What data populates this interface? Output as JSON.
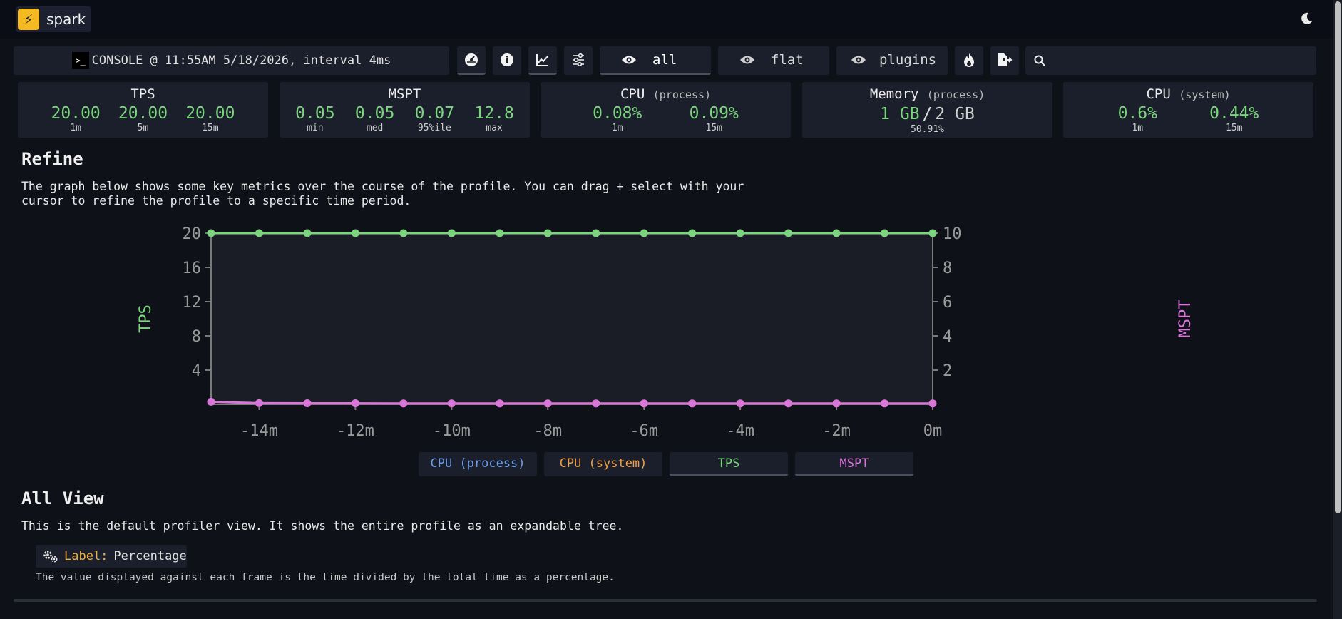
{
  "app": {
    "name": "spark"
  },
  "toolbar": {
    "console_text": "CONSOLE @ 11:55AM 5/18/2026, interval 4ms",
    "views": [
      {
        "label": "all",
        "active": true
      },
      {
        "label": "flat",
        "active": false
      },
      {
        "label": "plugins",
        "active": false
      }
    ],
    "icons": [
      "gauge-icon",
      "info-icon",
      "graph-icon",
      "sliders-icon"
    ],
    "search_placeholder": ""
  },
  "stats": {
    "tps": {
      "title": "TPS",
      "values": [
        {
          "num": "20.00",
          "label": "1m"
        },
        {
          "num": "20.00",
          "label": "5m"
        },
        {
          "num": "20.00",
          "label": "15m"
        }
      ]
    },
    "mspt": {
      "title": "MSPT",
      "values": [
        {
          "num": "0.05",
          "label": "min"
        },
        {
          "num": "0.05",
          "label": "med"
        },
        {
          "num": "0.07",
          "label": "95%ile"
        },
        {
          "num": "12.8",
          "label": "max"
        }
      ]
    },
    "cpu_process": {
      "title": "CPU",
      "sub": "(process)",
      "values": [
        {
          "num": "0.08%",
          "label": "1m"
        },
        {
          "num": "0.09%",
          "label": "15m"
        }
      ]
    },
    "memory": {
      "title": "Memory",
      "sub": "(process)",
      "used": "1 GB",
      "sep": "/",
      "total": "2 GB",
      "pct": "50.91%"
    },
    "cpu_system": {
      "title": "CPU",
      "sub": "(system)",
      "values": [
        {
          "num": "0.6%",
          "label": "1m"
        },
        {
          "num": "0.44%",
          "label": "15m"
        }
      ]
    }
  },
  "refine": {
    "heading": "Refine",
    "text_line1": "The graph below shows some key metrics over the course of the profile. You can drag + select with your",
    "text_line2": "cursor to refine the profile to a specific time period."
  },
  "chart_data": {
    "type": "line",
    "x_labels": [
      "-14m",
      "-12m",
      "-10m",
      "-8m",
      "-6m",
      "-4m",
      "-2m",
      "0m"
    ],
    "x": [
      -15,
      -14,
      -13,
      -12,
      -11,
      -10,
      -9,
      -8,
      -7,
      -6,
      -5,
      -4,
      -3,
      -2,
      -1,
      0
    ],
    "y_left_label": "TPS",
    "y_right_label": "MSPT",
    "y_left_ticks": [
      "4",
      "8",
      "12",
      "16",
      "20"
    ],
    "y_right_ticks": [
      "2",
      "4",
      "6",
      "8",
      "10"
    ],
    "y_left_range": [
      0,
      20
    ],
    "y_right_range": [
      0,
      10
    ],
    "series": [
      {
        "name": "TPS",
        "axis": "left",
        "color": "#7dd47f",
        "values": [
          20,
          20,
          20,
          20,
          20,
          20,
          20,
          20,
          20,
          20,
          20,
          20,
          20,
          20,
          20,
          20
        ]
      },
      {
        "name": "MSPT",
        "axis": "right",
        "color": "#d977d9",
        "values": [
          0.15,
          0.07,
          0.06,
          0.06,
          0.05,
          0.05,
          0.05,
          0.05,
          0.05,
          0.05,
          0.05,
          0.05,
          0.05,
          0.05,
          0.05,
          0.05
        ]
      }
    ]
  },
  "legend": [
    {
      "label": "CPU (process)",
      "color": "#6f9ee8",
      "active": false
    },
    {
      "label": "CPU (system)",
      "color": "#f0a04a",
      "active": false
    },
    {
      "label": "TPS",
      "color": "#7dd47f",
      "active": true
    },
    {
      "label": "MSPT",
      "color": "#d977d9",
      "active": true
    }
  ],
  "all_view": {
    "heading": "All View",
    "text": "This is the default profiler view. It shows the entire profile as an expandable tree.",
    "label_key": "Label:",
    "label_value": "Percentage",
    "note": "The value displayed against each frame is the time divided by the total time as a percentage."
  }
}
